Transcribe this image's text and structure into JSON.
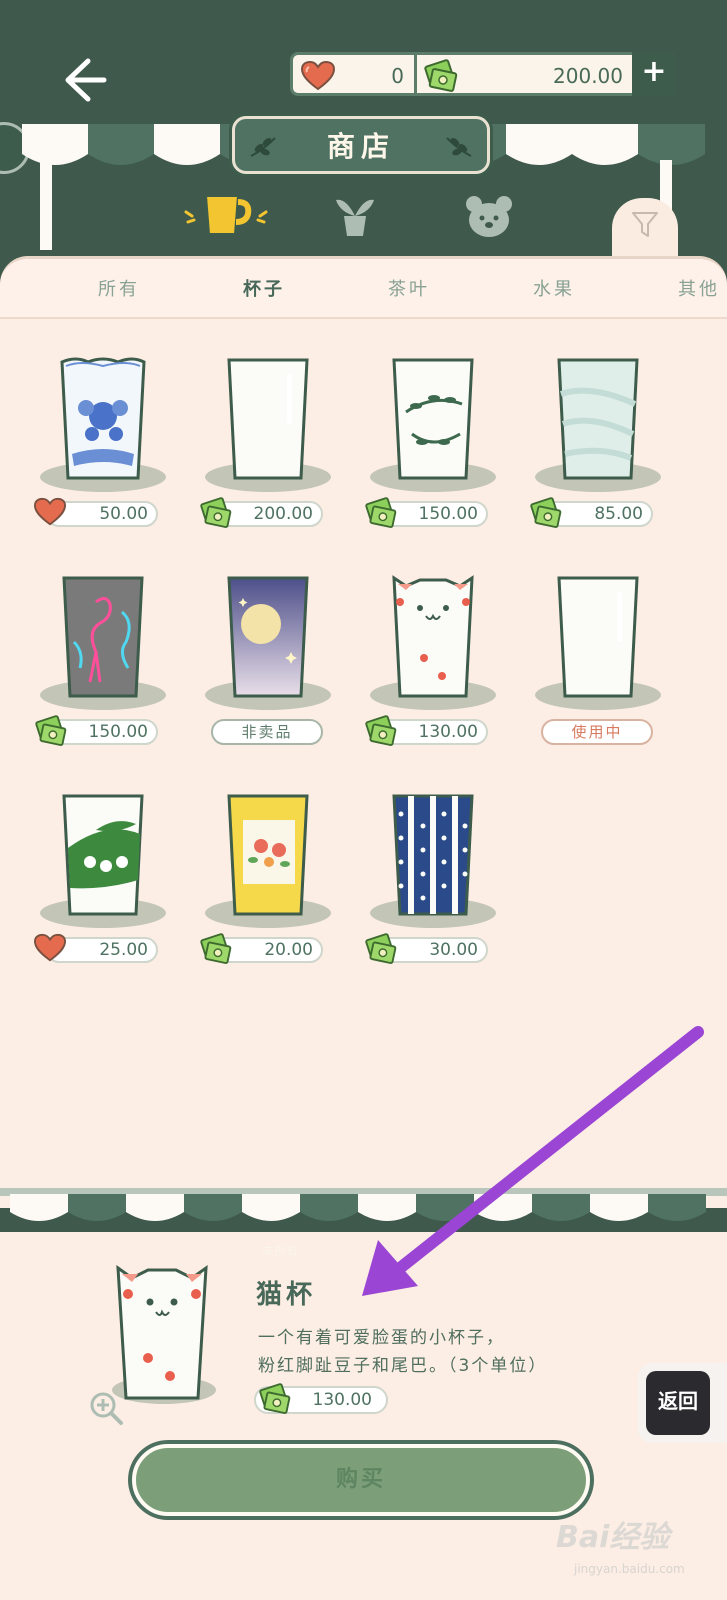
{
  "header": {
    "hearts": "0",
    "money": "200.00",
    "plus_label": "+"
  },
  "shop": {
    "title": "商店"
  },
  "tabs": [
    {
      "label": "所有"
    },
    {
      "label": "杯子"
    },
    {
      "label": "茶叶"
    },
    {
      "label": "水果"
    },
    {
      "label": "其他"
    }
  ],
  "items": [
    {
      "currency": "heart",
      "price": "50.00"
    },
    {
      "currency": "money",
      "price": "200.00"
    },
    {
      "currency": "money",
      "price": "150.00"
    },
    {
      "currency": "money",
      "price": "85.00"
    },
    {
      "currency": "money",
      "price": "150.00"
    },
    {
      "status": "非卖品"
    },
    {
      "currency": "money",
      "price": "130.00"
    },
    {
      "status": "使用中"
    },
    {
      "currency": "heart",
      "price": "25.00"
    },
    {
      "currency": "money",
      "price": "20.00"
    },
    {
      "currency": "money",
      "price": "30.00"
    }
  ],
  "detail": {
    "tag": "未拥有",
    "name": "猫杯",
    "desc_line1": "一个有着可爱脸蛋的小杯子，",
    "desc_line2": "粉红脚趾豆子和尾巴。（3个单位）",
    "price": "130.00",
    "buy_label": "购买"
  },
  "return_label": "返回",
  "watermark": "Bai经验",
  "watermark_sub": "jingyan.baidu.com",
  "colors": {
    "dark_green": "#3f5a4c",
    "panel": "#fdeee5",
    "accent_pink": "#e65e7c",
    "annotation_arrow": "#9a45d4"
  }
}
